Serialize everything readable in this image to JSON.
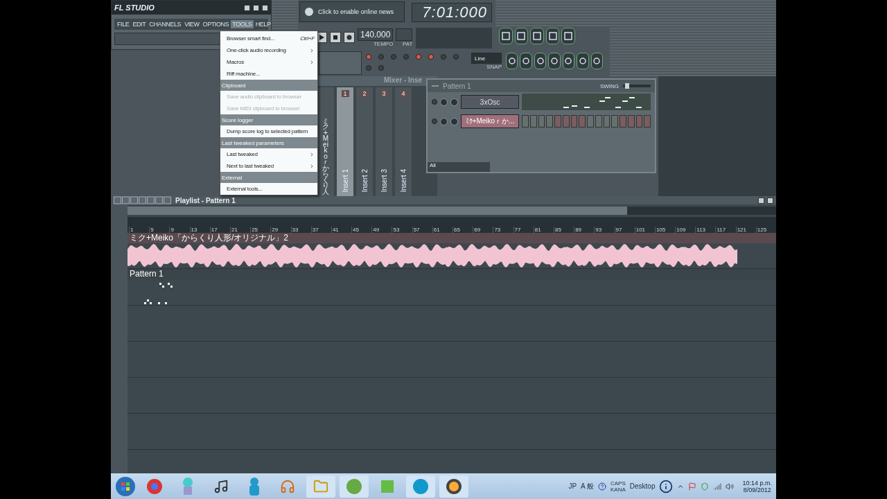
{
  "app": {
    "logo": "FL STUDIO",
    "menu": [
      {
        "label": "FILE",
        "selected": false
      },
      {
        "label": "EDIT",
        "selected": false
      },
      {
        "label": "CHANNELS",
        "selected": false
      },
      {
        "label": "VIEW",
        "selected": false
      },
      {
        "label": "OPTIONS",
        "selected": false
      },
      {
        "label": "TOOLS",
        "selected": true
      },
      {
        "label": "HELP",
        "selected": false
      }
    ]
  },
  "news": {
    "text": "Click to enable online news"
  },
  "time_display": {
    "value": "7:01:000"
  },
  "transport": {
    "tempo": "140.000",
    "tempo_label": "TEMPO",
    "pat_label": "PAT",
    "snap": "Line",
    "snap_label": "SNAP"
  },
  "tools_menu": [
    {
      "kind": "item",
      "label": "Browser smart find...",
      "shortcut": "Ctrl+F",
      "submenu": false,
      "disabled": false
    },
    {
      "kind": "item",
      "label": "One-click audio recording",
      "submenu": true,
      "disabled": false
    },
    {
      "kind": "item",
      "label": "Macros",
      "submenu": true,
      "disabled": false
    },
    {
      "kind": "item",
      "label": "Riff machine...",
      "submenu": false,
      "disabled": false
    },
    {
      "kind": "header",
      "label": "Clipboard"
    },
    {
      "kind": "item",
      "label": "Save audio clipboard to browser",
      "submenu": false,
      "disabled": true
    },
    {
      "kind": "item",
      "label": "Save MIDI clipboard to browser",
      "submenu": false,
      "disabled": true
    },
    {
      "kind": "header",
      "label": "Score logger"
    },
    {
      "kind": "item",
      "label": "Dump score log to selected pattern",
      "submenu": false,
      "disabled": false
    },
    {
      "kind": "header",
      "label": "Last tweaked parameters"
    },
    {
      "kind": "item",
      "label": "Last tweaked",
      "submenu": true,
      "disabled": false
    },
    {
      "kind": "item",
      "label": "Next to last tweaked",
      "submenu": true,
      "disabled": false
    },
    {
      "kind": "header",
      "label": "External"
    },
    {
      "kind": "item",
      "label": "External tools...",
      "submenu": false,
      "disabled": false
    }
  ],
  "mixer": {
    "title": "Mixer - Inse",
    "tracks": [
      {
        "label": "ミク+Meikoｒからくり人",
        "selected": false
      },
      {
        "label": "Insert 1",
        "number": "1",
        "selected": true
      },
      {
        "label": "Insert 2",
        "number": "2",
        "selected": false
      },
      {
        "label": "Insert 3",
        "number": "3",
        "selected": false
      },
      {
        "label": "Insert 4",
        "number": "4",
        "selected": false
      }
    ]
  },
  "channel_rack": {
    "title": "Pattern 1",
    "swing": {
      "label": "SWING",
      "level": 0.1
    },
    "channels": [
      {
        "kind": "pianoroll",
        "name": "3xOsc"
      },
      {
        "kind": "steps",
        "name": "ﾐｸ+Meikoｒか..."
      }
    ],
    "filter": "All"
  },
  "playlist": {
    "title": "Playlist - Pattern 1",
    "ruler": [
      "1",
      "5",
      "9",
      "13",
      "17",
      "21",
      "25",
      "29",
      "33",
      "37",
      "41",
      "45",
      "49",
      "53",
      "57",
      "61",
      "65",
      "69",
      "73",
      "77",
      "81",
      "85",
      "89",
      "93",
      "97",
      "101",
      "105",
      "109",
      "113",
      "117",
      "121",
      "125"
    ],
    "clips": [
      {
        "kind": "audio",
        "label": "ミク+Meiko「からくり人形/オリジナル」2"
      },
      {
        "kind": "pattern",
        "label": "Pattern 1"
      }
    ]
  },
  "taskbar": {
    "language": "JP",
    "ime": "A 般",
    "caps": "CAPS",
    "kana": "KANA",
    "desktop": "Desktop",
    "time": "10:14 p.m.",
    "date": "8/09/2012"
  }
}
